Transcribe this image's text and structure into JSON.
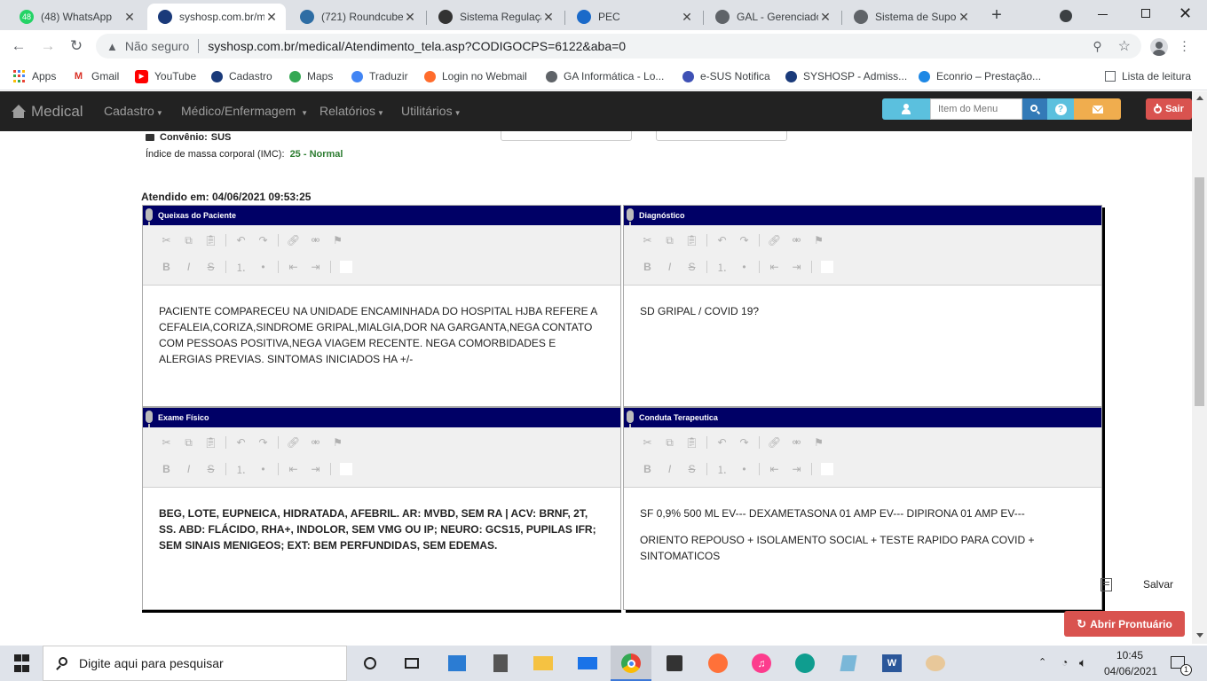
{
  "browser": {
    "tabs": [
      {
        "label": "(48) WhatsApp",
        "badge": "48",
        "icon": "whatsapp-icon",
        "color": "#25d366"
      },
      {
        "label": "syshosp.com.br/m",
        "icon": "syshosp-icon",
        "color": "#1a3a7a",
        "active": true
      },
      {
        "label": "(721) Roundcube",
        "icon": "roundcube-icon",
        "color": "#2e6da4"
      },
      {
        "label": "Sistema Regulaçã",
        "icon": "regulacao-icon",
        "color": "#333333"
      },
      {
        "label": "PEC",
        "icon": "pec-icon",
        "color": "#1b6ac9"
      },
      {
        "label": "GAL - Gerenciado",
        "icon": "globe-icon",
        "color": "#5f6368"
      },
      {
        "label": "Sistema de Supor",
        "icon": "globe-icon",
        "color": "#5f6368"
      }
    ],
    "security_label": "Não seguro",
    "url": "syshosp.com.br/medical/Atendimento_tela.asp?CODIGOCPS=6122&aba=0",
    "bookmarks": [
      {
        "label": "Apps",
        "icon": "apps-grid-icon",
        "color": "#e53935"
      },
      {
        "label": "Gmail",
        "icon": "gmail-icon",
        "color": "#d93025"
      },
      {
        "label": "YouTube",
        "icon": "youtube-icon",
        "color": "#ff0000"
      },
      {
        "label": "Cadastro",
        "icon": "syshosp-icon",
        "color": "#1a3a7a"
      },
      {
        "label": "Maps",
        "icon": "maps-icon",
        "color": "#34a853"
      },
      {
        "label": "Traduzir",
        "icon": "translate-icon",
        "color": "#4285f4"
      },
      {
        "label": "Login no Webmail",
        "icon": "cpanel-icon",
        "color": "#ff6c2c"
      },
      {
        "label": "GA Informática - Lo...",
        "icon": "globe-icon",
        "color": "#5f6368"
      },
      {
        "label": "e-SUS Notifica",
        "icon": "esus-icon",
        "color": "#3f51b5"
      },
      {
        "label": "SYSHOSP - Admiss...",
        "icon": "syshosp-icon",
        "color": "#1a3a7a"
      },
      {
        "label": "Econrio – Prestação...",
        "icon": "cube-icon",
        "color": "#1e88e5"
      }
    ],
    "reading_list": "Lista de leitura"
  },
  "app": {
    "brand": "Medical",
    "menu": [
      "Cadastro",
      "Médico/Enfermagem",
      "Relatórios",
      "Utilitários"
    ],
    "search_placeholder": "Item do Menu",
    "logout_label": "Sair"
  },
  "patient": {
    "convenio_label": "Convênio:",
    "convenio_value": "SUS",
    "imc_label": "Índice de massa corporal (IMC):",
    "imc_value": "25 - Normal"
  },
  "attended": "Atendido em: 04/06/2021 09:53:25",
  "panels": [
    {
      "id": "queixas",
      "title": "Queixas do Paciente",
      "bold": false,
      "paragraphs": [
        "PACIENTE COMPARECEU NA UNIDADE ENCAMINHADA DO HOSPITAL HJBA REFERE A CEFALEIA,CORIZA,SINDROME GRIPAL,MIALGIA,DOR NA GARGANTA,NEGA CONTATO COM PESSOAS POSITIVA,NEGA VIAGEM RECENTE. NEGA COMORBIDADES E ALERGIAS PREVIAS. SINTOMAS INICIADOS HA +/-"
      ]
    },
    {
      "id": "diagnostico",
      "title": "Diagnóstico",
      "bold": false,
      "paragraphs": [
        "SD GRIPAL / COVID 19?"
      ]
    },
    {
      "id": "exame",
      "title": "Exame Físico",
      "bold": true,
      "paragraphs": [
        "BEG, LOTE, EUPNEICA, HIDRATADA, AFEBRIL. AR: MVBD, SEM RA | ACV: BRNF, 2T, SS. ABD: FLÁCIDO, RHA+, INDOLOR,  SEM VMG OU IP; NEURO: GCS15, PUPILAS IFR; SEM SINAIS MENIGEOS; EXT: BEM PERFUNDIDAS, SEM EDEMAS."
      ]
    },
    {
      "id": "conduta",
      "title": "Conduta Terapeutica",
      "bold": false,
      "paragraphs": [
        "SF 0,9% 500 ML EV--- DEXAMETASONA 01 AMP EV--- DIPIRONA 01 AMP EV---",
        "ORIENTO REPOUSO + ISOLAMENTO SOCIAL + TESTE RAPIDO PARA COVID + SINTOMATICOS"
      ]
    }
  ],
  "save_label": "Salvar",
  "open_record_label": "Abrir Prontuário",
  "taskbar": {
    "search_placeholder": "Digite aqui para pesquisar",
    "time": "10:45",
    "date": "04/06/2021",
    "notification_count": "1"
  }
}
